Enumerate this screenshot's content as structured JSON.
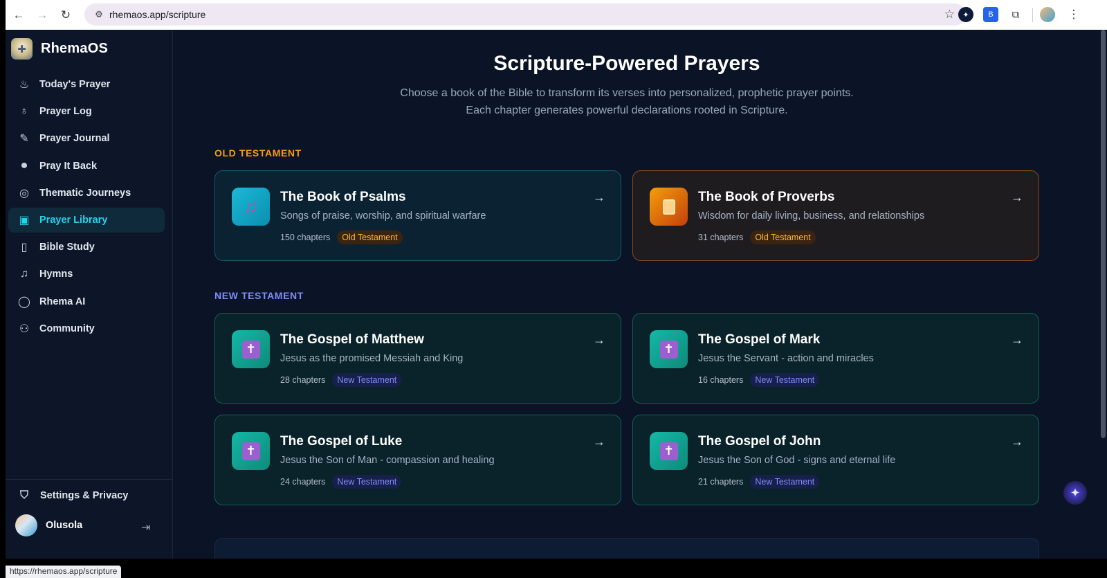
{
  "browser": {
    "url": "rhemaos.app/scripture",
    "status_url": "https://rhemaos.app/scripture"
  },
  "sidebar": {
    "brand": "RhemaOS",
    "items": [
      {
        "label": "Today's Prayer",
        "icon": "flame-icon"
      },
      {
        "label": "Prayer Log",
        "icon": "award-icon"
      },
      {
        "label": "Prayer Journal",
        "icon": "pen-icon"
      },
      {
        "label": "Pray It Back",
        "icon": "microphone-icon"
      },
      {
        "label": "Thematic Journeys",
        "icon": "compass-icon"
      },
      {
        "label": "Prayer Library",
        "icon": "book-icon",
        "active": true
      },
      {
        "label": "Bible Study",
        "icon": "open-book-icon"
      },
      {
        "label": "Hymns",
        "icon": "music-icon"
      },
      {
        "label": "Rhema AI",
        "icon": "chat-icon"
      },
      {
        "label": "Community",
        "icon": "users-icon"
      }
    ],
    "settings": "Settings & Privacy",
    "user_name": "Olusola"
  },
  "main": {
    "title": "Scripture-Powered Prayers",
    "subtitle_line1": "Choose a book of the Bible to transform its verses into personalized, prophetic prayer points.",
    "subtitle_line2": "Each chapter generates powerful declarations rooted in Scripture.",
    "old_testament_label": "OLD TESTAMENT",
    "new_testament_label": "NEW TESTAMENT",
    "books": [
      {
        "title": "The Book of Psalms",
        "description": "Songs of praise, worship, and spiritual warfare",
        "chapters": "150 chapters",
        "tag": "Old Testament",
        "icon": "music-note-icon"
      },
      {
        "title": "The Book of Proverbs",
        "description": "Wisdom for daily living, business, and relationships",
        "chapters": "31 chapters",
        "tag": "Old Testament",
        "icon": "scroll-icon"
      },
      {
        "title": "The Gospel of Matthew",
        "description": "Jesus as the promised Messiah and King",
        "chapters": "28 chapters",
        "tag": "New Testament",
        "icon": "cross-icon"
      },
      {
        "title": "The Gospel of Mark",
        "description": "Jesus the Servant - action and miracles",
        "chapters": "16 chapters",
        "tag": "New Testament",
        "icon": "cross-icon"
      },
      {
        "title": "The Gospel of Luke",
        "description": "Jesus the Son of Man - compassion and healing",
        "chapters": "24 chapters",
        "tag": "New Testament",
        "icon": "cross-icon"
      },
      {
        "title": "The Gospel of John",
        "description": "Jesus the Son of God - signs and eternal life",
        "chapters": "21 chapters",
        "tag": "New Testament",
        "icon": "cross-icon"
      }
    ],
    "arrow": "→"
  },
  "colors": {
    "accent": "#22d3ee",
    "old_testament": "#f59e0b",
    "new_testament": "#818cf8",
    "background": "#0b1426"
  }
}
